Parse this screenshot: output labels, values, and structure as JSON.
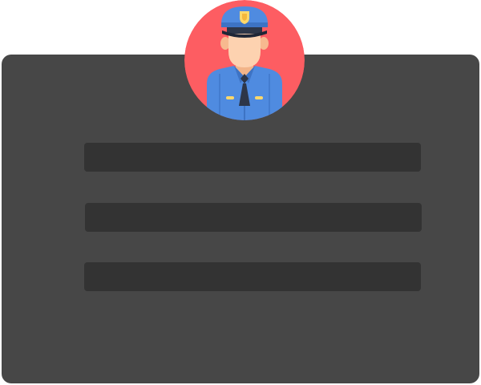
{
  "avatar": {
    "icon": "police-officer-icon",
    "background_color": "#fd5d62"
  },
  "form": {
    "fields": [
      {
        "value": "",
        "placeholder": ""
      },
      {
        "value": "",
        "placeholder": ""
      },
      {
        "value": "",
        "placeholder": ""
      }
    ]
  },
  "colors": {
    "card": "#474747",
    "field": "#333333",
    "uniform": "#4f8be0",
    "skin": "#fdd2b0"
  }
}
